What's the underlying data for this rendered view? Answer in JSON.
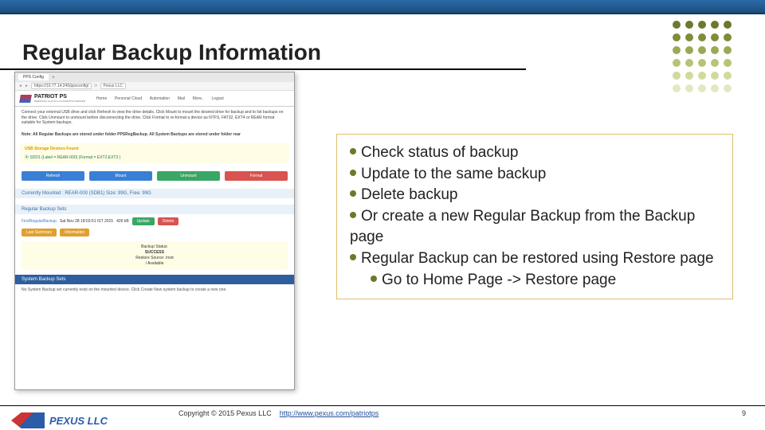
{
  "title": "Regular Backup Information",
  "decoration": {
    "dot_colors": [
      "#6b7a2a",
      "#7d8d3a",
      "#99aa55",
      "#b7c377",
      "#d1d99c",
      "#e4e8c2"
    ]
  },
  "screenshot": {
    "tab_label": "PPS Config",
    "url": "https://10.77.14.245/ppsconfig/",
    "search_label": "Pexus LLC",
    "brand": "PATRIOT PS",
    "brand_sub": "PERSONAL CLOUD & AUTOMATION SERVER",
    "nav": {
      "home": "Home",
      "pc": "Personal Cloud",
      "auto": "Automation",
      "mail": "Mail",
      "more": "More..",
      "logout": "Logout"
    },
    "intro": "Connect your external USB drive and click Refresh to view the drive details. Click Mount to mount the desired drive for backup and to list backups on the drive. Click Unmount to unmount before disconnecting the drive. Click Format to re-format a device as NTFS, FAT32, EXT4 or REAR format suitable for System backups.",
    "note": "Note: All Regular Backups are stored under folder PPSRegBackup. All System Backups are stored under folder rear",
    "usb_head": "USB Storage Devices Found",
    "usb_device": "SDD1 (Label = REAR-000) (Format = EXT2,EXT3 )",
    "buttons": {
      "refresh": "Refresh",
      "mount": "Mount",
      "unmount": "Unmount",
      "format": "Format"
    },
    "mounted_head": "Currently Mounted : REAR-000 (SDB1) Size: 99G, Free: 99G",
    "regular_head": "Regular Backup Sets",
    "backup_row": {
      "name": "FirstRegularBackup",
      "date": "Sat Nov 28 18:03:51 IST 2015",
      "size": "426 kB",
      "last_summary": "Last Summary",
      "information": "Information",
      "update": "Update",
      "delete": "Delete"
    },
    "info_panel": {
      "status_label": "Backup Status:",
      "status_value": "SUCCESS",
      "source_label": "Restore Source: /root",
      "available": "/ Available"
    },
    "system_head": "System Backup Sets",
    "no_system": "No System Backup set currently exist on the mounted device. Click Create New system backup to create a new one."
  },
  "bullets": {
    "b1": "Check status of backup",
    "b2": "Update to the same backup",
    "b3": "Delete backup",
    "b4": "Or create a new Regular Backup from the Backup page",
    "b5": "Regular Backup can be restored using Restore  page",
    "b6": "Go to Home Page -> Restore page"
  },
  "footer": {
    "logo_text": "PEXUS LLC",
    "copyright": "Copyright © 2015  Pexus LLC",
    "link_text": "http://www.pexus.com/patriotps",
    "page_number": "9"
  }
}
